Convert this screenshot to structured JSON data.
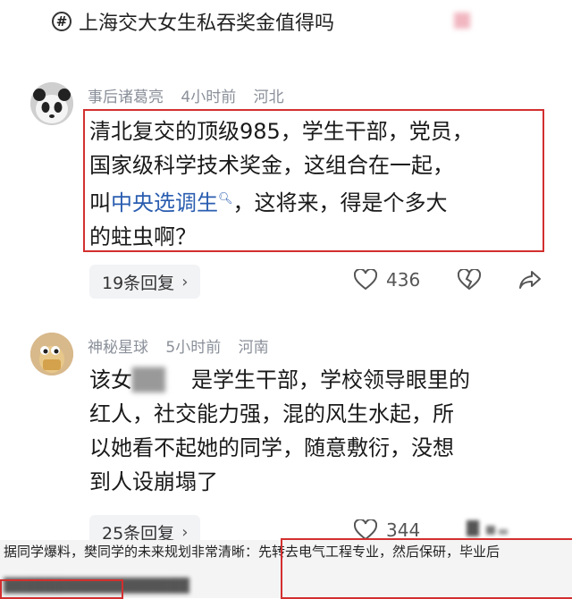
{
  "topic": {
    "hash_icon": "#",
    "title": "上海交大女生私吞奖金值得吗"
  },
  "comments": [
    {
      "username": "事后诸葛亮",
      "time": "4小时前",
      "location": "河北",
      "avatar_icon": "panda-avatar-icon",
      "text_line1": "清北复交的顶级985，学生干部，党员，",
      "text_line2": "国家级科学技术奖金，这组合在一起，",
      "text_line3_prefix": "叫",
      "text_line3_link": "中央选调生",
      "text_line3_suffix": "，这将来，得是个多大",
      "text_line4": "的蛀虫啊？",
      "replies": "19条回复",
      "likes": "436"
    },
    {
      "username": "神秘星球",
      "time": "5小时前",
      "location": "河南",
      "avatar_icon": "cartoon-avatar-icon",
      "text_line1_a": "该女",
      "text_line1_b": "是学生干部，学校领导眼里的",
      "text_line2": "红人，社交能力强，混的风生水起，所",
      "text_line3": "以她看不起她的同学，随意敷衍，没想",
      "text_line4": "到人设崩塌了",
      "replies": "25条回复",
      "likes": "344"
    }
  ],
  "caption": {
    "line1_a": "据同学爆料，樊同学的未来规划非常清晰：",
    "line1_b": "先转去电气工程专业，然后保研，毕业后"
  },
  "colors": {
    "highlight": "#d32f2f",
    "link": "#2a5db0",
    "meta": "#8a8f99"
  }
}
